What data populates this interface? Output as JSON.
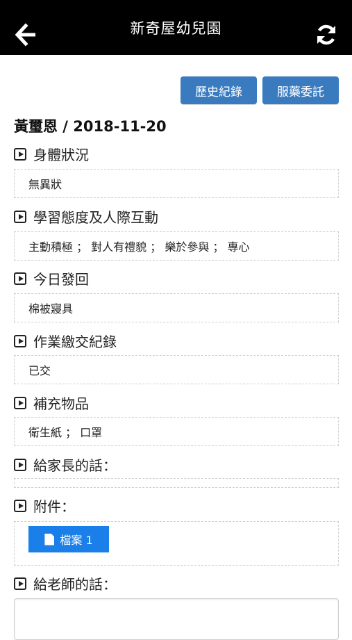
{
  "header": {
    "title": "新奇屋幼兒園"
  },
  "toolbar": {
    "history_label": "歷史紀錄",
    "medication_label": "服藥委託"
  },
  "student": {
    "line": "黃璽恩 / 2018-11-20"
  },
  "sections": [
    {
      "title": "身體狀況",
      "value": "無異狀"
    },
    {
      "title": "學習態度及人際互動",
      "value": "主動積極 ； 對人有禮貌 ； 樂於參與 ； 專心"
    },
    {
      "title": "今日發回",
      "value": "棉被寢具"
    },
    {
      "title": "作業繳交紀錄",
      "value": "已交"
    },
    {
      "title": "補充物品",
      "value": "衛生紙 ； 口罩"
    },
    {
      "title": "給家長的話：",
      "value": ""
    },
    {
      "title": "附件：",
      "file_label": "檔案 1"
    },
    {
      "title": "給老師的話："
    }
  ]
}
